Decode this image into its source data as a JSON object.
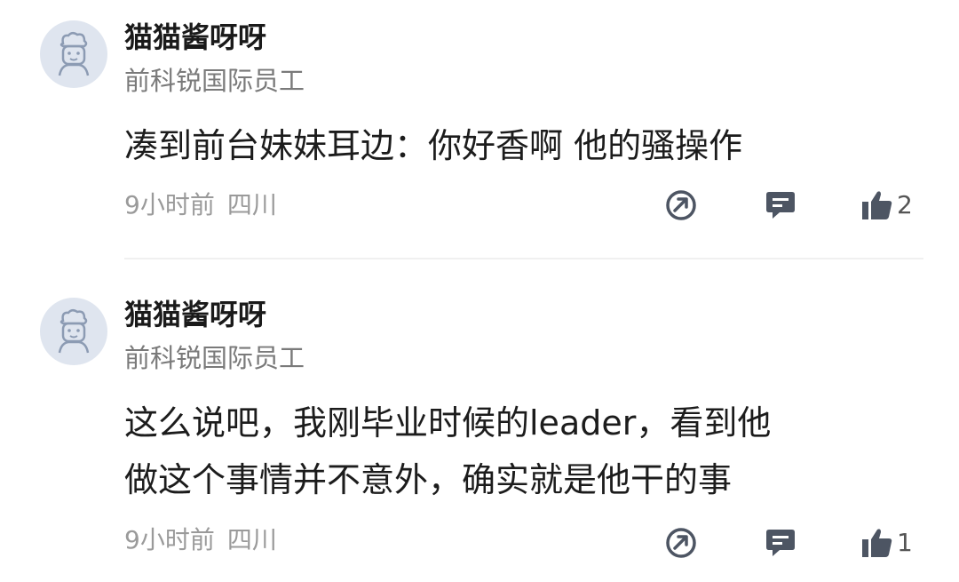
{
  "comments": [
    {
      "username": "猫猫酱呀呀",
      "title": "前科锐国际员工",
      "text_lines": [
        "凑到前台妹妹耳边：你好香啊 他的骚操作"
      ],
      "time": "9小时前",
      "location": "四川",
      "likes": "2"
    },
    {
      "username": "猫猫酱呀呀",
      "title": "前科锐国际员工",
      "text_lines": [
        "这么说吧，我刚毕业时候的leader，看到他",
        "做这个事情并不意外，确实就是他干的事"
      ],
      "time": "9小时前",
      "location": "四川",
      "likes": "1"
    }
  ],
  "icons": {
    "avatar": "avatar-icon",
    "share": "share-icon",
    "reply": "reply-icon",
    "like": "thumbs-up-icon"
  },
  "colors": {
    "icon": "#4d5563",
    "avatar_bg": "#dfe5ef",
    "meta": "#9a9a9a"
  }
}
